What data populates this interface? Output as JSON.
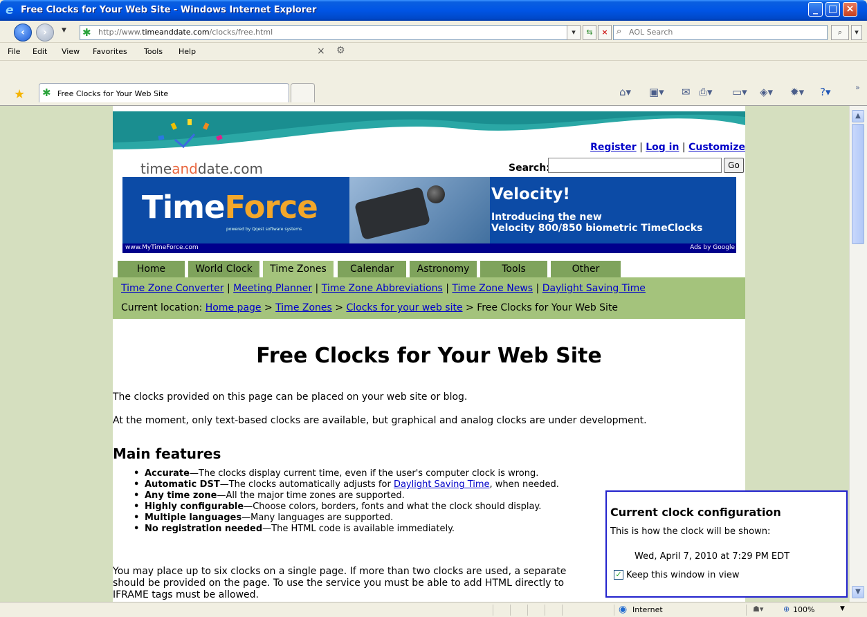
{
  "window": {
    "title": "Free Clocks for Your Web Site - Windows Internet Explorer"
  },
  "address": {
    "url_prefix": "http://www.",
    "url_domain": "timeanddate.com",
    "url_path": "/clocks/free.html"
  },
  "search": {
    "placeholder": "AOL Search"
  },
  "menu": [
    "File",
    "Edit",
    "View",
    "Favorites",
    "Tools",
    "Help"
  ],
  "tab": {
    "label": "Free Clocks for Your Web Site"
  },
  "site": {
    "logo_a": "time",
    "logo_b": "and",
    "logo_c": "date.com",
    "links": [
      "Register",
      "Log in",
      "Customize"
    ],
    "search_label": "Search:",
    "search_button": "Go"
  },
  "ad": {
    "brand_a": "Time",
    "brand_b": "Force",
    "powered": "powered by Qqest software systems",
    "headline": "Velocity!",
    "line1": "Introducing the new",
    "line2": "Velocity 800/850 biometric TimeClocks",
    "url": "www.MyTimeForce.com",
    "ads_by": "Ads by Google"
  },
  "nav": {
    "tabs": [
      "Home",
      "World Clock",
      "Time Zones",
      "Calendar",
      "Astronomy",
      "Tools",
      "Other"
    ],
    "active": "Time Zones",
    "sublinks": [
      "Time Zone Converter",
      "Meeting Planner",
      "Time Zone Abbreviations",
      "Time Zone News",
      "Daylight Saving Time"
    ],
    "location_label": "Current location:",
    "crumbs": [
      "Home page",
      "Time Zones",
      "Clocks for your web site"
    ],
    "current": "Free Clocks for Your Web Site"
  },
  "content": {
    "heading": "Free Clocks for Your Web Site",
    "p1": "The clocks provided on this page can be placed on your web site or blog.",
    "p2": "At the moment, only text-based clocks are available, but graphical and analog clocks are under development.",
    "features_heading": "Main features",
    "features": [
      {
        "b": "Accurate",
        "t": "—The clocks display current time, even if the user's computer clock is wrong."
      },
      {
        "b": "Automatic DST",
        "t": "—The clocks automatically adjusts for ",
        "link": "Daylight Saving Time",
        "t2": ", when needed."
      },
      {
        "b": "Any time zone",
        "t": "—All the major time zones are supported."
      },
      {
        "b": "Highly configurable",
        "t": "—Choose colors, borders, fonts and what the clock should display."
      },
      {
        "b": "Multiple languages",
        "t": "—Many languages are supported."
      },
      {
        "b": "No registration needed",
        "t": "—The HTML code is available immediately."
      }
    ],
    "p3_line1": "You may place up to six clocks on a single page. If more than two clocks are used, a separate",
    "p3_line2": "should be provided on the page. To use the service you must be able to add HTML directly to",
    "p3_line3": "IFRAME tags must be allowed."
  },
  "config": {
    "title": "Current clock configuration",
    "desc": "This is how the clock will be shown:",
    "clock": "Wed, April 7, 2010 at 7:29 PM EDT",
    "keep_label": "Keep this window in view",
    "keep_checked": true
  },
  "status": {
    "zone": "Internet",
    "zoom": "100%"
  }
}
